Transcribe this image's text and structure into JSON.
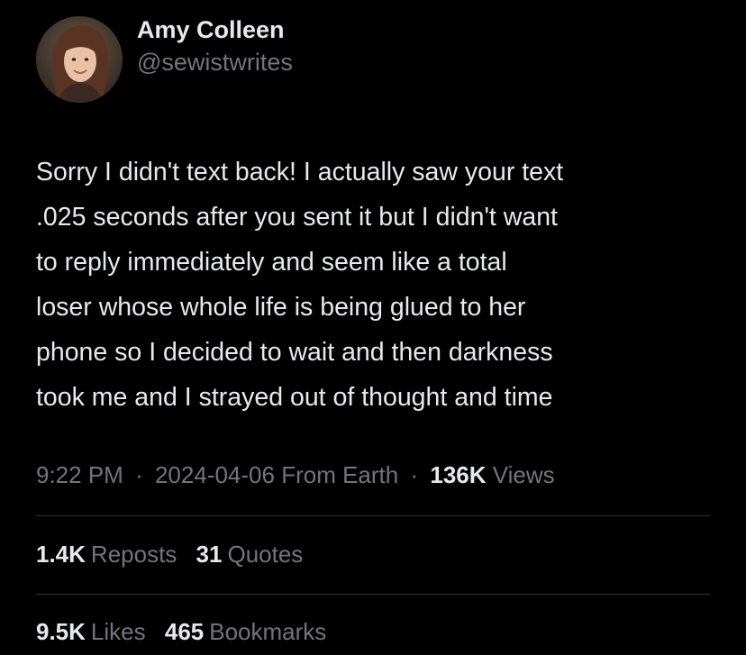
{
  "author": {
    "display_name": "Amy Colleen",
    "handle": "@sewistwrites",
    "avatar_icon": "profile-photo"
  },
  "tweet": {
    "text_lines": [
      "Sorry I didn't text back! I actually saw your text",
      ".025 seconds after you sent it but I didn't want",
      "to reply immediately and seem like a total",
      "loser whose whole life is being glued to her",
      "phone so I decided to wait and then darkness",
      "took me and I strayed out of thought and time"
    ]
  },
  "meta": {
    "time": "9:22 PM",
    "separator": "·",
    "date": "2024-04-06",
    "source": "From Earth",
    "views_count": "136K",
    "views_label": "Views"
  },
  "stats": {
    "reposts_count": "1.4K",
    "reposts_label": "Reposts",
    "quotes_count": "31",
    "quotes_label": "Quotes",
    "likes_count": "9.5K",
    "likes_label": "Likes",
    "bookmarks_count": "465",
    "bookmarks_label": "Bookmarks"
  },
  "colors": {
    "background": "#000000",
    "primary_text": "#e7e9ea",
    "secondary_text": "#71767b",
    "divider": "#2f3336"
  }
}
